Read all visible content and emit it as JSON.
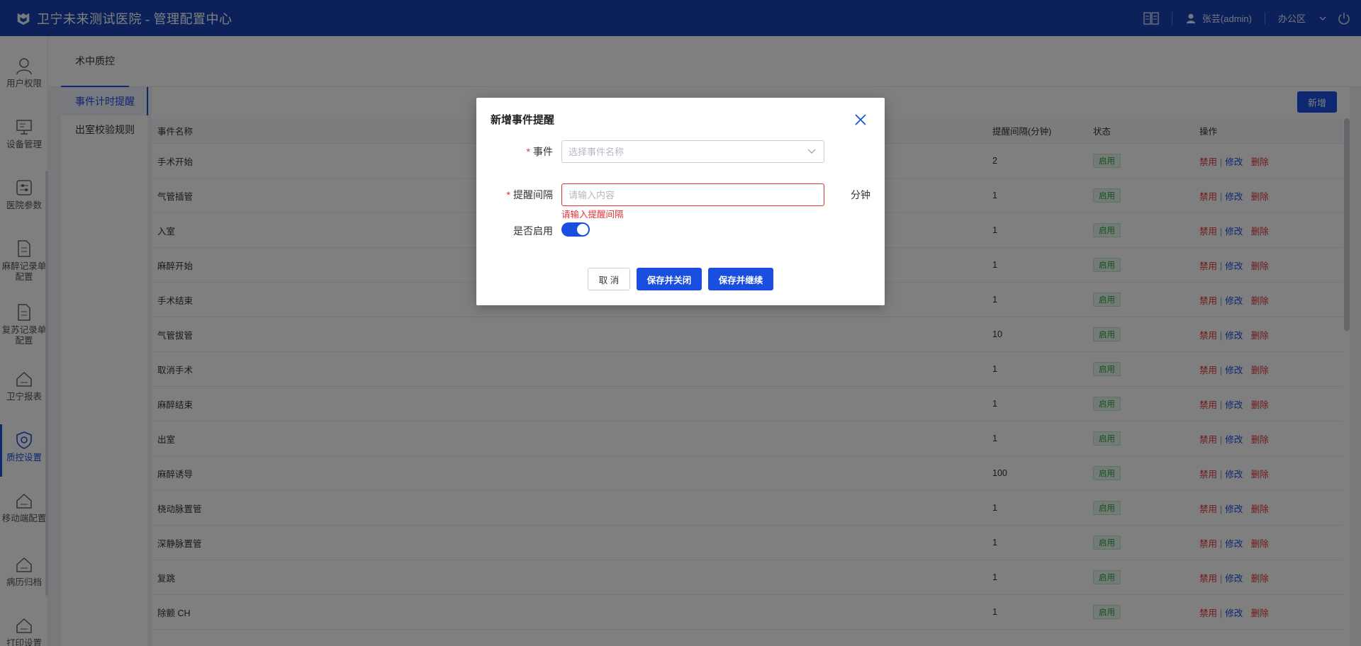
{
  "header": {
    "app_title": "卫宁未来测试医院 - 管理配置中心",
    "user": "张芸(admin)",
    "location": "办公区"
  },
  "sidebar": {
    "items": [
      {
        "label": "用户权限",
        "icon": "user-icon"
      },
      {
        "label": "设备管理",
        "icon": "monitor-icon"
      },
      {
        "label": "医院参数",
        "icon": "sliders-icon"
      },
      {
        "label": "麻醉记录单配置",
        "icon": "document-icon"
      },
      {
        "label": "复苏记录单配置",
        "icon": "document-icon"
      },
      {
        "label": "卫宁报表",
        "icon": "home-icon"
      },
      {
        "label": "质控设置",
        "icon": "shield-icon"
      },
      {
        "label": "移动端配置",
        "icon": "home-icon"
      },
      {
        "label": "病历归档",
        "icon": "home-icon"
      },
      {
        "label": "打印设置",
        "icon": "home-icon"
      }
    ]
  },
  "top_tab": {
    "label": "术中质控"
  },
  "submenu": {
    "items": [
      {
        "label": "事件计时提醒"
      },
      {
        "label": "出室校验规则"
      }
    ]
  },
  "content": {
    "new_button": "新增",
    "columns": {
      "name": "事件名称",
      "interval": "提醒间隔(分钟)",
      "status": "状态",
      "ops": "操作"
    },
    "ops_labels": {
      "disable": "禁用",
      "edit": "修改",
      "delete": "删除"
    },
    "rows": [
      {
        "name": "手术开始",
        "interval": "2",
        "status": "启用"
      },
      {
        "name": "气管插管",
        "interval": "1",
        "status": "启用"
      },
      {
        "name": "入室",
        "interval": "1",
        "status": "启用"
      },
      {
        "name": "麻醉开始",
        "interval": "1",
        "status": "启用"
      },
      {
        "name": "手术结束",
        "interval": "1",
        "status": "启用"
      },
      {
        "name": "气管拔管",
        "interval": "10",
        "status": "启用"
      },
      {
        "name": "取消手术",
        "interval": "1",
        "status": "启用"
      },
      {
        "name": "麻醉结束",
        "interval": "1",
        "status": "启用"
      },
      {
        "name": "出室",
        "interval": "1",
        "status": "启用"
      },
      {
        "name": "麻醉诱导",
        "interval": "100",
        "status": "启用"
      },
      {
        "name": "桡动脉置管",
        "interval": "1",
        "status": "启用"
      },
      {
        "name": "深静脉置管",
        "interval": "1",
        "status": "启用"
      },
      {
        "name": "复跳",
        "interval": "1",
        "status": "启用"
      },
      {
        "name": "除颤 CH",
        "interval": "1",
        "status": "启用"
      }
    ]
  },
  "modal": {
    "title": "新增事件提醒",
    "event_label": "事件",
    "event_placeholder": "选择事件名称",
    "interval_label": "提醒间隔",
    "interval_placeholder": "请输入内容",
    "interval_unit": "分钟",
    "interval_error": "请输入提醒间隔",
    "enabled_label": "是否启用",
    "enabled": true,
    "cancel_button": "取 消",
    "save_close_button": "保存并关闭",
    "save_continue_button": "保存并继续"
  },
  "colors": {
    "primary": "#1a4ee0",
    "header": "#1843b5",
    "danger": "#e03434",
    "success": "#29a745"
  }
}
